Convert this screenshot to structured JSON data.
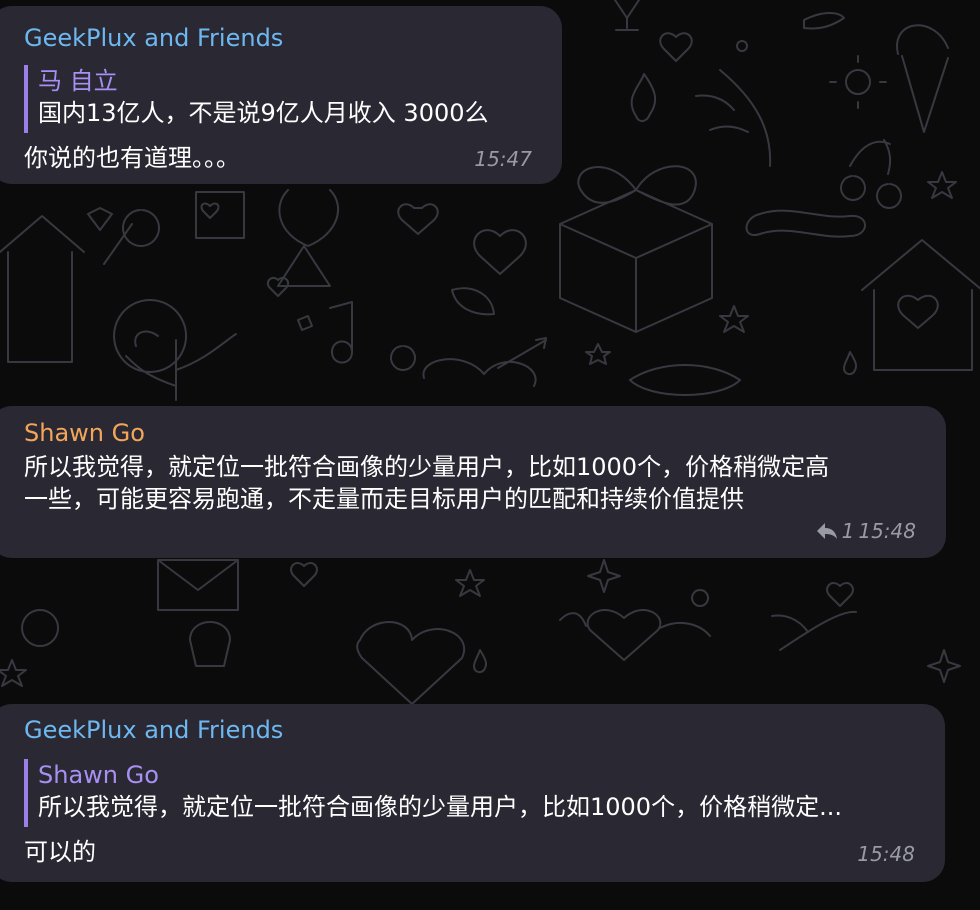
{
  "chat": {
    "messages": [
      {
        "sender": "GeekPlux and Friends",
        "quote_author": "马 自立",
        "quote_text": "国内13亿人，不是说9亿人月收入 3000么",
        "text": "你说的也有道理。。。",
        "time": "15:47"
      },
      {
        "sender": "Shawn Go",
        "text_line_1": "所以我觉得，就定位一批符合画像的少量用户，比如1000个，价格稍微定高",
        "text_line_2": "一些，可能更容易跑通，不走量而走目标用户的匹配和持续价值提供",
        "replies": "1",
        "time": "15:48",
        "reply_icon": "reply-arrow-icon"
      },
      {
        "sender": "GeekPlux and Friends",
        "quote_author": "Shawn Go",
        "quote_text": "所以我觉得，就定位一批符合画像的少量用户，比如1000个，价格稍微定...",
        "text": "可以的",
        "time": "15:48"
      }
    ]
  },
  "colors": {
    "background": "#0b0b0c",
    "bubble": "#2a2933",
    "sender_blue": "#6eb8f2",
    "sender_orange": "#f3a65a",
    "quote_accent": "#9a80e8",
    "meta": "#9a9aa4"
  }
}
